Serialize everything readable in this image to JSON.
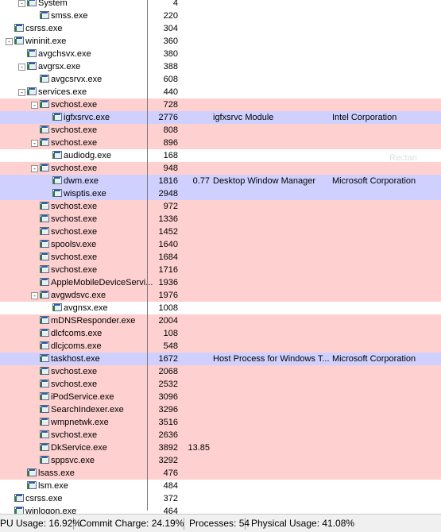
{
  "processes": [
    {
      "name": "System",
      "pid": "4",
      "indent": 1,
      "toggle": "-",
      "bg": "plain",
      "cpu": "",
      "desc": "",
      "comp": ""
    },
    {
      "name": "smss.exe",
      "pid": "220",
      "indent": 2,
      "toggle": "",
      "bg": "plain",
      "cpu": "",
      "desc": "",
      "comp": ""
    },
    {
      "name": "csrss.exe",
      "pid": "304",
      "indent": 0,
      "toggle": "",
      "bg": "plain",
      "cpu": "",
      "desc": "",
      "comp": ""
    },
    {
      "name": "wininit.exe",
      "pid": "360",
      "indent": 0,
      "toggle": "-",
      "bg": "plain",
      "cpu": "",
      "desc": "",
      "comp": ""
    },
    {
      "name": "avgchsvx.exe",
      "pid": "380",
      "indent": 1,
      "toggle": "",
      "bg": "plain",
      "cpu": "",
      "desc": "",
      "comp": ""
    },
    {
      "name": "avgrsx.exe",
      "pid": "388",
      "indent": 1,
      "toggle": "-",
      "bg": "plain",
      "cpu": "",
      "desc": "",
      "comp": ""
    },
    {
      "name": "avgcsrvx.exe",
      "pid": "608",
      "indent": 2,
      "toggle": "",
      "bg": "plain",
      "cpu": "",
      "desc": "",
      "comp": ""
    },
    {
      "name": "services.exe",
      "pid": "440",
      "indent": 1,
      "toggle": "-",
      "bg": "plain",
      "cpu": "",
      "desc": "",
      "comp": ""
    },
    {
      "name": "svchost.exe",
      "pid": "728",
      "indent": 2,
      "toggle": "-",
      "bg": "svc",
      "cpu": "",
      "desc": "",
      "comp": ""
    },
    {
      "name": "igfxsrvc.exe",
      "pid": "2776",
      "indent": 3,
      "toggle": "",
      "bg": "own",
      "cpu": "",
      "desc": "igfxsrvc Module",
      "comp": "Intel Corporation"
    },
    {
      "name": "svchost.exe",
      "pid": "808",
      "indent": 2,
      "toggle": "",
      "bg": "svc",
      "cpu": "",
      "desc": "",
      "comp": ""
    },
    {
      "name": "svchost.exe",
      "pid": "896",
      "indent": 2,
      "toggle": "-",
      "bg": "svc",
      "cpu": "",
      "desc": "",
      "comp": ""
    },
    {
      "name": "audiodg.exe",
      "pid": "168",
      "indent": 3,
      "toggle": "",
      "bg": "plain",
      "cpu": "",
      "desc": "",
      "comp": ""
    },
    {
      "name": "svchost.exe",
      "pid": "948",
      "indent": 2,
      "toggle": "-",
      "bg": "svc",
      "cpu": "",
      "desc": "",
      "comp": ""
    },
    {
      "name": "dwm.exe",
      "pid": "1816",
      "indent": 3,
      "toggle": "",
      "bg": "own",
      "cpu": "0.77",
      "desc": "Desktop Window Manager",
      "comp": "Microsoft Corporation"
    },
    {
      "name": "wisptis.exe",
      "pid": "2948",
      "indent": 3,
      "toggle": "",
      "bg": "own",
      "cpu": "",
      "desc": "",
      "comp": ""
    },
    {
      "name": "svchost.exe",
      "pid": "972",
      "indent": 2,
      "toggle": "",
      "bg": "svc",
      "cpu": "",
      "desc": "",
      "comp": ""
    },
    {
      "name": "svchost.exe",
      "pid": "1336",
      "indent": 2,
      "toggle": "",
      "bg": "svc",
      "cpu": "",
      "desc": "",
      "comp": ""
    },
    {
      "name": "svchost.exe",
      "pid": "1452",
      "indent": 2,
      "toggle": "",
      "bg": "svc",
      "cpu": "",
      "desc": "",
      "comp": ""
    },
    {
      "name": "spoolsv.exe",
      "pid": "1640",
      "indent": 2,
      "toggle": "",
      "bg": "svc",
      "cpu": "",
      "desc": "",
      "comp": ""
    },
    {
      "name": "svchost.exe",
      "pid": "1684",
      "indent": 2,
      "toggle": "",
      "bg": "svc",
      "cpu": "",
      "desc": "",
      "comp": ""
    },
    {
      "name": "svchost.exe",
      "pid": "1716",
      "indent": 2,
      "toggle": "",
      "bg": "svc",
      "cpu": "",
      "desc": "",
      "comp": ""
    },
    {
      "name": "AppleMobileDeviceServi...",
      "pid": "1936",
      "indent": 2,
      "toggle": "",
      "bg": "svc",
      "cpu": "",
      "desc": "",
      "comp": ""
    },
    {
      "name": "avgwdsvc.exe",
      "pid": "1976",
      "indent": 2,
      "toggle": "-",
      "bg": "svc",
      "cpu": "",
      "desc": "",
      "comp": ""
    },
    {
      "name": "avgnsx.exe",
      "pid": "1008",
      "indent": 3,
      "toggle": "",
      "bg": "plain",
      "cpu": "",
      "desc": "",
      "comp": ""
    },
    {
      "name": "mDNSResponder.exe",
      "pid": "2004",
      "indent": 2,
      "toggle": "",
      "bg": "svc",
      "cpu": "",
      "desc": "",
      "comp": ""
    },
    {
      "name": "dlcfcoms.exe",
      "pid": "108",
      "indent": 2,
      "toggle": "",
      "bg": "svc",
      "cpu": "",
      "desc": "",
      "comp": ""
    },
    {
      "name": "dlcjcoms.exe",
      "pid": "548",
      "indent": 2,
      "toggle": "",
      "bg": "svc",
      "cpu": "",
      "desc": "",
      "comp": ""
    },
    {
      "name": "taskhost.exe",
      "pid": "1672",
      "indent": 2,
      "toggle": "",
      "bg": "own",
      "cpu": "",
      "desc": "Host Process for Windows T...",
      "comp": "Microsoft Corporation"
    },
    {
      "name": "svchost.exe",
      "pid": "2068",
      "indent": 2,
      "toggle": "",
      "bg": "svc",
      "cpu": "",
      "desc": "",
      "comp": ""
    },
    {
      "name": "svchost.exe",
      "pid": "2532",
      "indent": 2,
      "toggle": "",
      "bg": "svc",
      "cpu": "",
      "desc": "",
      "comp": ""
    },
    {
      "name": "iPodService.exe",
      "pid": "3096",
      "indent": 2,
      "toggle": "",
      "bg": "svc",
      "cpu": "",
      "desc": "",
      "comp": ""
    },
    {
      "name": "SearchIndexer.exe",
      "pid": "3296",
      "indent": 2,
      "toggle": "",
      "bg": "svc",
      "cpu": "",
      "desc": "",
      "comp": ""
    },
    {
      "name": "wmpnetwk.exe",
      "pid": "3516",
      "indent": 2,
      "toggle": "",
      "bg": "svc",
      "cpu": "",
      "desc": "",
      "comp": ""
    },
    {
      "name": "svchost.exe",
      "pid": "2636",
      "indent": 2,
      "toggle": "",
      "bg": "svc",
      "cpu": "",
      "desc": "",
      "comp": ""
    },
    {
      "name": "DkService.exe",
      "pid": "3892",
      "indent": 2,
      "toggle": "",
      "bg": "svc",
      "cpu": "13.85",
      "desc": "",
      "comp": ""
    },
    {
      "name": "sppsvc.exe",
      "pid": "3292",
      "indent": 2,
      "toggle": "",
      "bg": "svc",
      "cpu": "",
      "desc": "",
      "comp": ""
    },
    {
      "name": "lsass.exe",
      "pid": "476",
      "indent": 1,
      "toggle": "",
      "bg": "svc",
      "cpu": "",
      "desc": "",
      "comp": ""
    },
    {
      "name": "lsm.exe",
      "pid": "484",
      "indent": 1,
      "toggle": "",
      "bg": "plain",
      "cpu": "",
      "desc": "",
      "comp": ""
    },
    {
      "name": "csrss.exe",
      "pid": "372",
      "indent": 0,
      "toggle": "",
      "bg": "plain",
      "cpu": "",
      "desc": "",
      "comp": ""
    },
    {
      "name": "winlogon.exe",
      "pid": "464",
      "indent": 0,
      "toggle": "",
      "bg": "plain",
      "cpu": "",
      "desc": "",
      "comp": ""
    }
  ],
  "overlay_text": "Rectan",
  "status": {
    "cpu": "PU Usage: 16.92%",
    "commit": "Commit Charge: 24.19%",
    "processes": "Processes: 54",
    "physical": "Physical Usage: 41.08%"
  },
  "colors": {
    "services_bg": "#ffd0d0",
    "own_process_bg": "#d0d0ff",
    "statusbar_bg": "#f0f0f0"
  },
  "icons": {
    "toggle": "tree-toggle-icon",
    "process": "process-window-icon"
  }
}
